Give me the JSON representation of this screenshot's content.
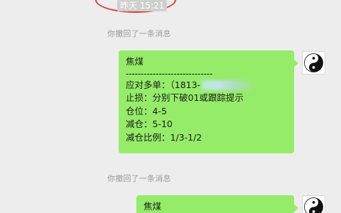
{
  "timestamp": "昨天 15:21",
  "recall_notices": [
    "你撤回了一条消息",
    "你撤回了一条消息"
  ],
  "messages": [
    {
      "title": "焦煤",
      "separator": "-----------------------------",
      "lines": [
        "应对多单：（1813-",
        "止损：分别下破01或跟踪提示",
        "仓位：4-5",
        "减仓：5-10",
        "减仓比例：1/3-1/2"
      ]
    },
    {
      "title": "焦煤"
    }
  ],
  "avatar_icon": "yin-yang-icon",
  "colors": {
    "background": "#ededed",
    "bubble": "#95ec69",
    "highlight_ring": "#e03a3a",
    "system_text": "#9b9b9b"
  }
}
